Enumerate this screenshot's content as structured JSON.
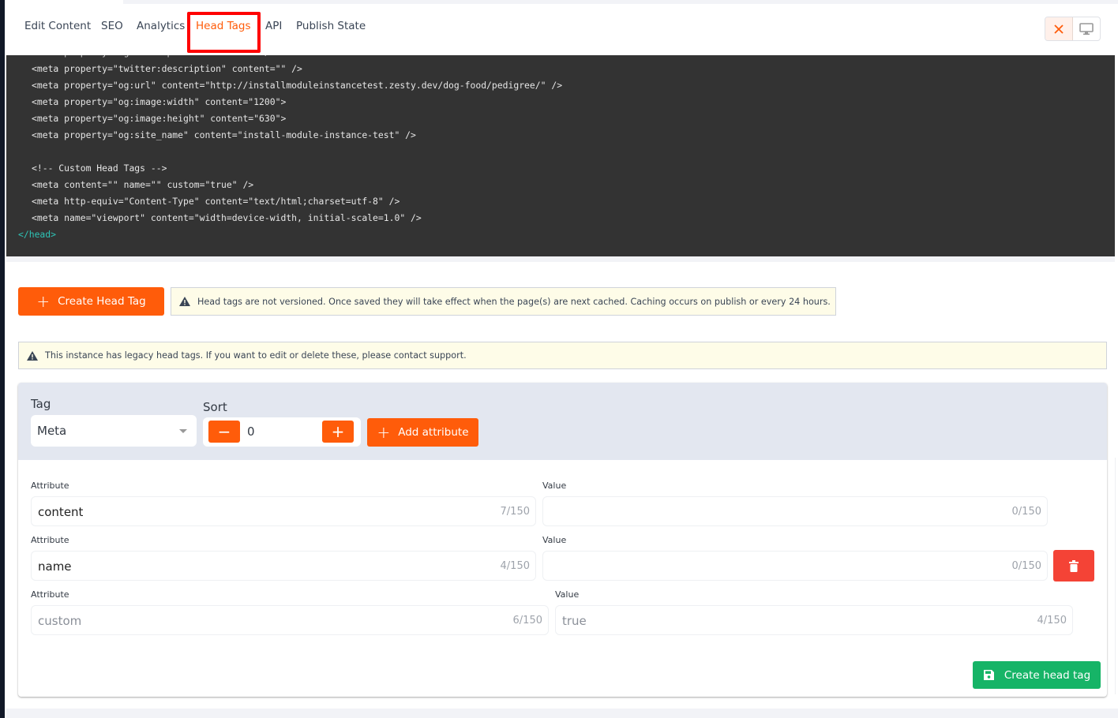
{
  "tabs": [
    {
      "label": "Edit Content",
      "active": false
    },
    {
      "label": "SEO",
      "active": false
    },
    {
      "label": "Analytics",
      "active": false
    },
    {
      "label": "Head Tags",
      "active": true
    },
    {
      "label": "API",
      "active": false
    },
    {
      "label": "Publish State",
      "active": false
    }
  ],
  "toolbar": {
    "close_icon": "close-icon",
    "preview_icon": "desktop-monitor-icon"
  },
  "code_preview": {
    "partial_top_line": "<meta property=\"og:description\" content=\"\" />",
    "lines": [
      "<meta property=\"twitter:description\" content=\"\" />",
      "<meta property=\"og:url\" content=\"http://installmoduleinstancetest.zesty.dev/dog-food/pedigree/\" />",
      "<meta property=\"og:image:width\" content=\"1200\">",
      "<meta property=\"og:image:height\" content=\"630\">",
      "<meta property=\"og:site_name\" content=\"install-module-instance-test\" />",
      "",
      "<!-- Custom Head Tags -->",
      "<meta content=\"\" name=\"\" custom=\"true\" />",
      "<meta http-equiv=\"Content-Type\" content=\"text/html;charset=utf-8\" />",
      "<meta name=\"viewport\" content=\"width=device-width, initial-scale=1.0\" />"
    ],
    "closing_tag": "</head>"
  },
  "actions": {
    "create_head_tag_label": "Create Head Tag",
    "versioning_notice": "Head tags are not versioned. Once saved they will take effect when the page(s) are next cached. Caching occurs on publish or every 24 hours.",
    "legacy_notice": "This instance has legacy head tags. If you want to edit or delete these, please contact support."
  },
  "form": {
    "tag_label": "Tag",
    "tag_value": "Meta",
    "sort_label": "Sort",
    "sort_value": "0",
    "sort_decrement": "−",
    "sort_increment": "+",
    "add_attribute_label": "Add attribute",
    "attributes": [
      {
        "attr_label": "Attribute",
        "attr_value": "content",
        "attr_count": "7/150",
        "value_label": "Value",
        "value": "",
        "value_count": "0/150",
        "disabled": false,
        "deletable": false
      },
      {
        "attr_label": "Attribute",
        "attr_value": "name",
        "attr_count": "4/150",
        "value_label": "Value",
        "value": "",
        "value_count": "0/150",
        "disabled": false,
        "deletable": true
      },
      {
        "attr_label": "Attribute",
        "attr_value": "custom",
        "attr_count": "6/150",
        "value_label": "Value",
        "value": "true",
        "value_count": "4/150",
        "disabled": true,
        "deletable": false
      }
    ],
    "save_label": "Create head tag"
  },
  "colors": {
    "accent": "#ff5c0a",
    "danger": "#f44336",
    "success": "#16b467",
    "highlight_box": "#ff0000",
    "code_bg": "#333333",
    "notice_bg": "#fefce8"
  }
}
